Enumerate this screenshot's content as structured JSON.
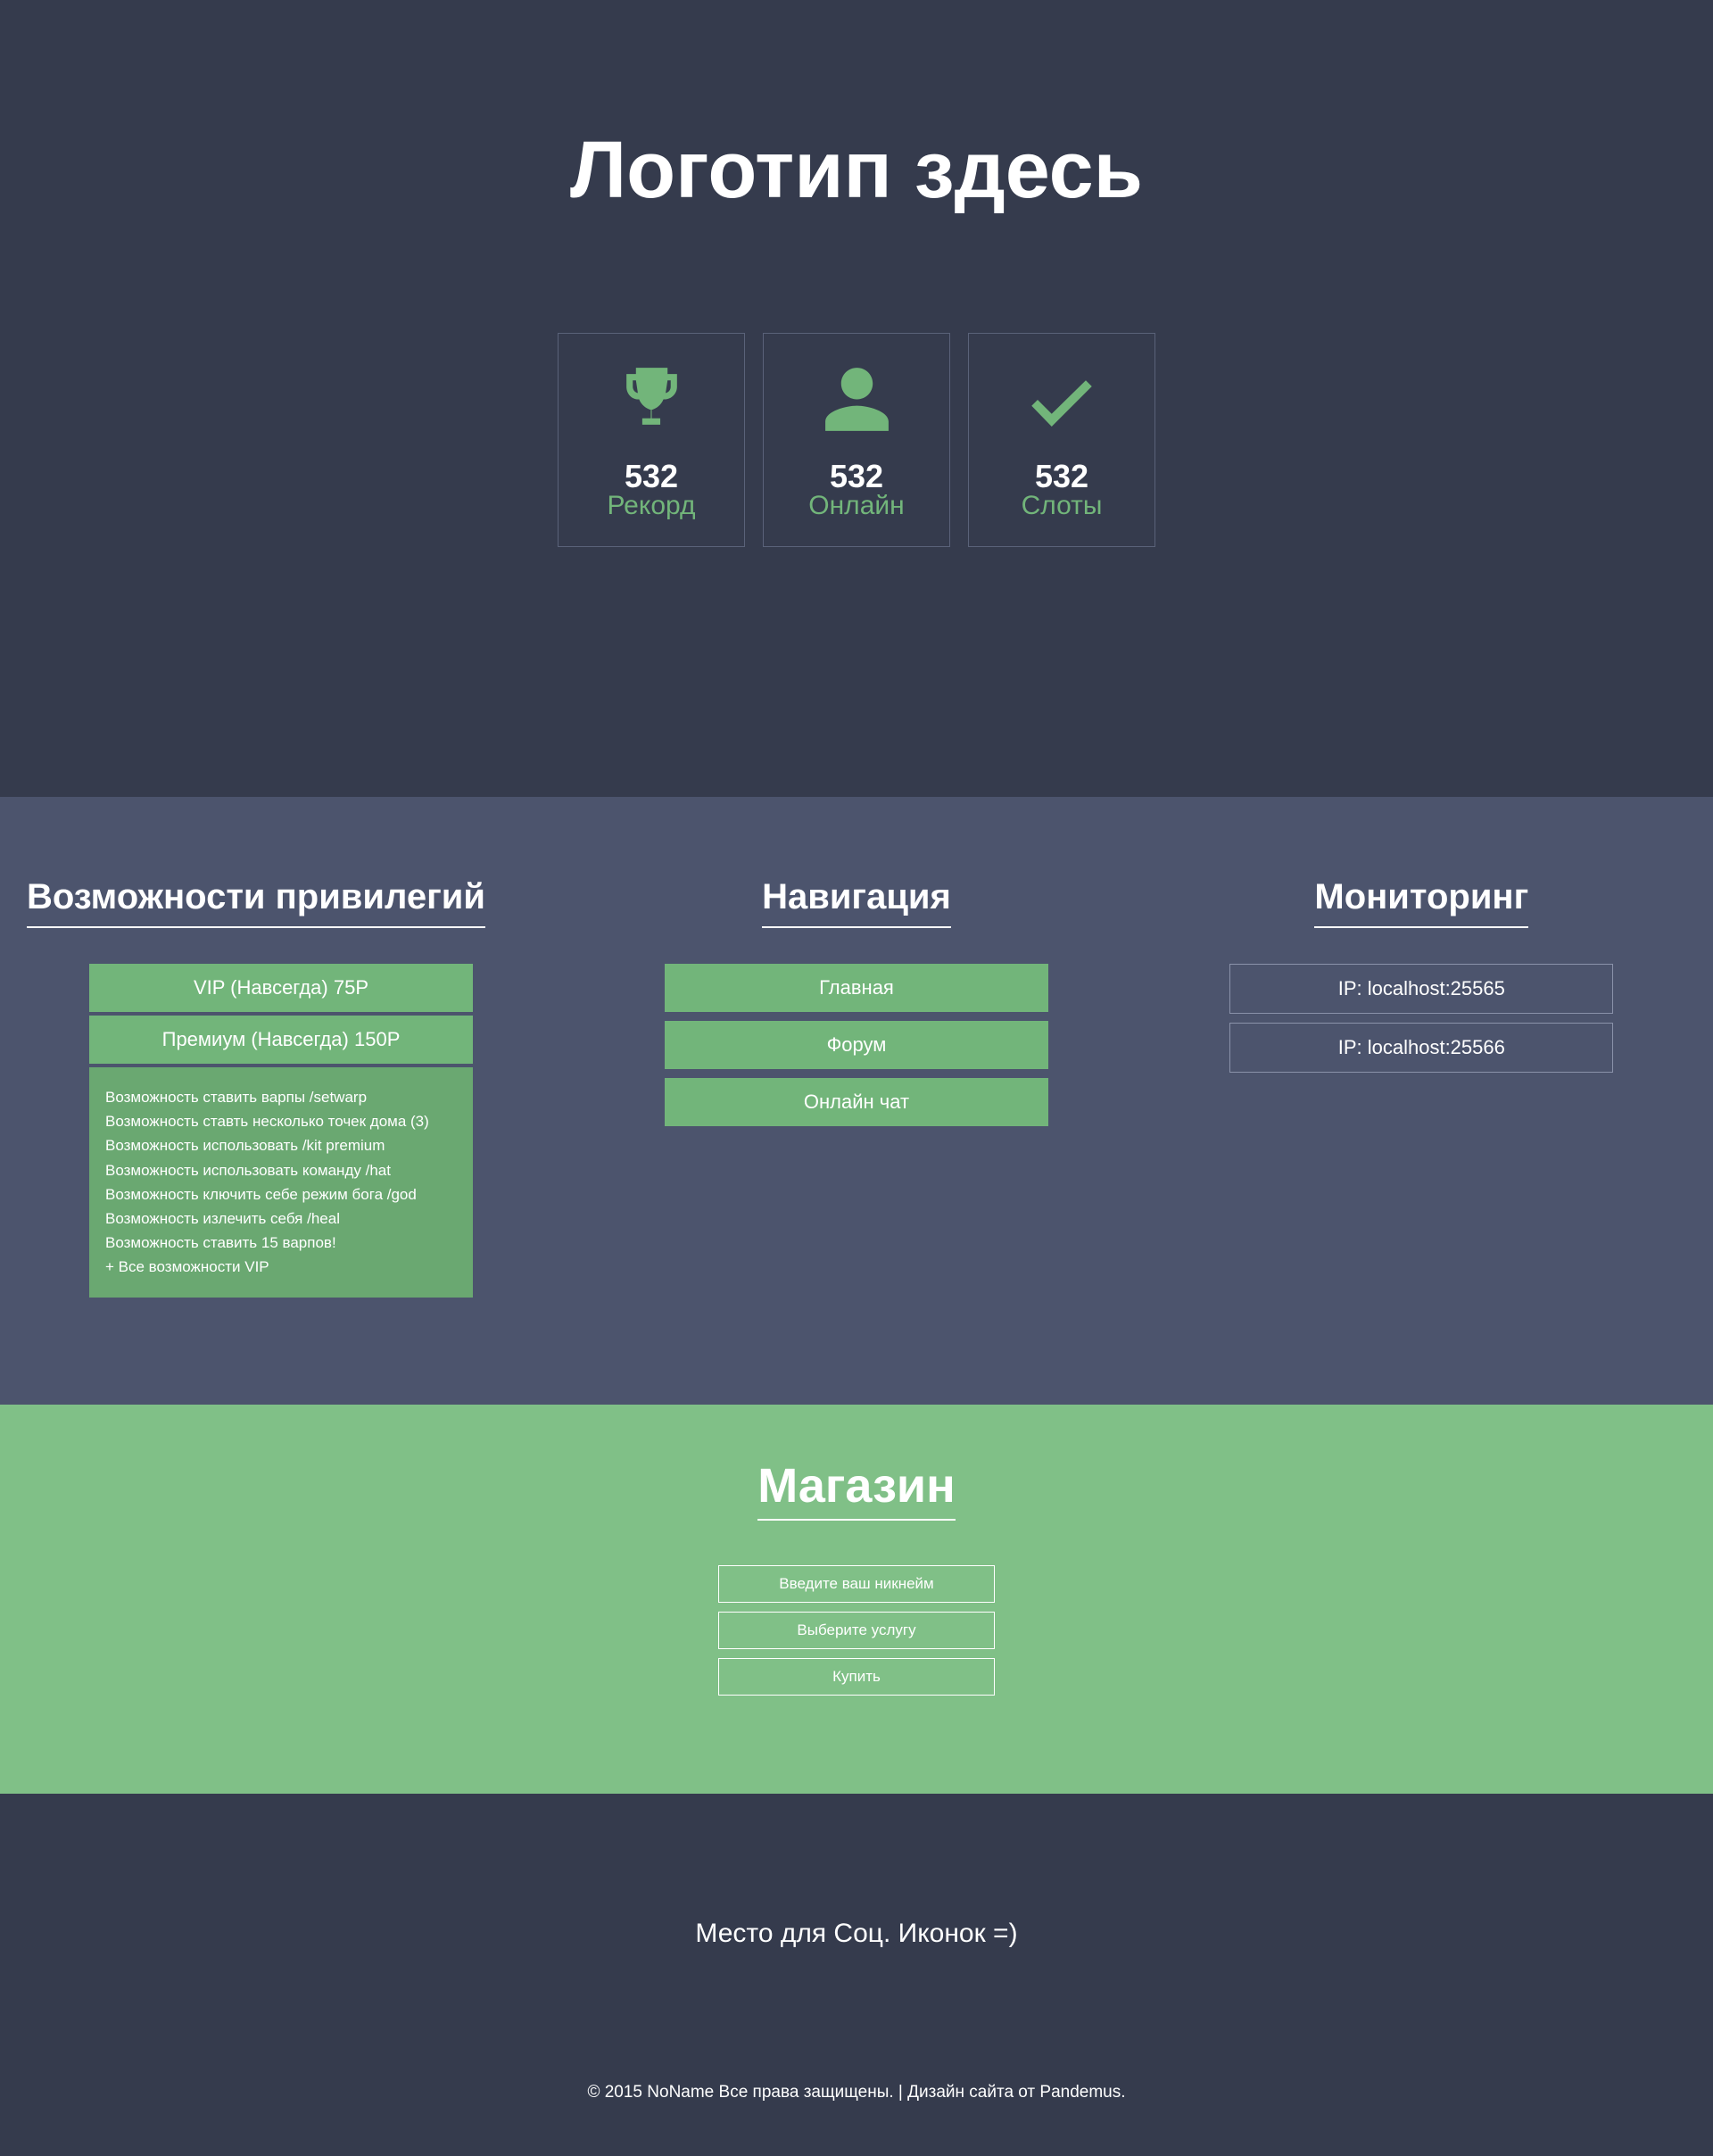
{
  "hero": {
    "title": "Логотип здесь",
    "stats": [
      {
        "icon": "trophy",
        "number": "532",
        "label": "Рекорд"
      },
      {
        "icon": "user",
        "number": "532",
        "label": "Онлайн"
      },
      {
        "icon": "check",
        "number": "532",
        "label": "Слоты"
      }
    ]
  },
  "privileges": {
    "title": "Возможности привилегий",
    "tabs": [
      "VIP (Навсегда) 75Р",
      "Премиум (Навсегда) 150Р"
    ],
    "features": [
      "Возможность ставить варпы /setwarp",
      "Возможность ставть несколько точек дома (3)",
      "Возможность использовать  /kit premium",
      "Возможность использовать команду /hat",
      "Возможность ключить себе режим бога /god",
      "Возможность излечить себя /heal",
      "Возможность ставить 15 варпов!",
      "+ Все возможности VIP"
    ]
  },
  "navigation": {
    "title": "Навигация",
    "links": [
      "Главная",
      "Форум",
      "Онлайн чат"
    ]
  },
  "monitoring": {
    "title": "Мониторинг",
    "servers": [
      "IP: localhost:25565",
      "IP: localhost:25566"
    ]
  },
  "shop": {
    "title": "Магазин",
    "nickname_placeholder": "Введите ваш никнейм",
    "service_placeholder": "Выберите услугу",
    "buy_label": "Купить"
  },
  "footer": {
    "social_text": "Место для Соц. Иконок =)",
    "copyright": "© 2015 NoName Все права защищены. | Дизайн сайта от Pandemus."
  }
}
